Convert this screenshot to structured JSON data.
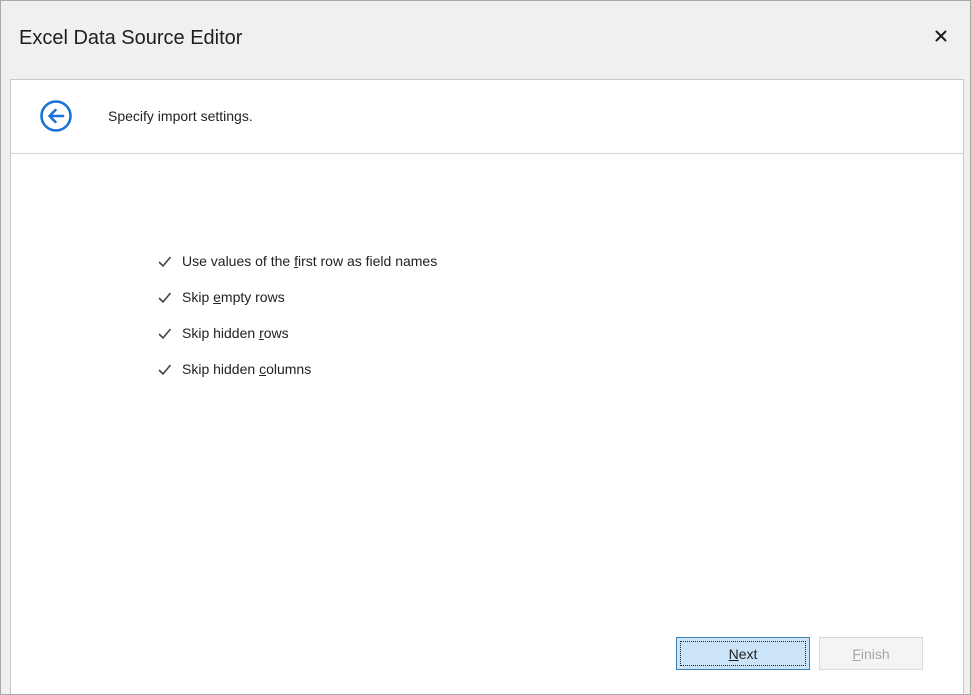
{
  "window": {
    "title": "Excel Data Source Editor"
  },
  "header": {
    "text": "Specify import settings."
  },
  "options": [
    {
      "before": "Use values of the ",
      "mnemonic": "f",
      "after": "irst row as field names",
      "checked": true
    },
    {
      "before": "Skip ",
      "mnemonic": "e",
      "after": "mpty rows",
      "checked": true
    },
    {
      "before": "Skip hidden ",
      "mnemonic": "r",
      "after": "ows",
      "checked": true
    },
    {
      "before": "Skip hidden ",
      "mnemonic": "c",
      "after": "olumns",
      "checked": true
    }
  ],
  "buttons": {
    "next": {
      "mnemonic": "N",
      "rest": "ext",
      "enabled": true
    },
    "finish": {
      "mnemonic": "F",
      "rest": "inish",
      "enabled": false
    }
  },
  "colors": {
    "accent": "#1a73d9",
    "next_bg": "#cce4f7",
    "next_border": "#3c7fb1",
    "disabled_text": "#a5a5a5"
  },
  "icons": {
    "back": "back-arrow-circle-icon",
    "close": "close-icon",
    "check": "checkmark-icon"
  }
}
